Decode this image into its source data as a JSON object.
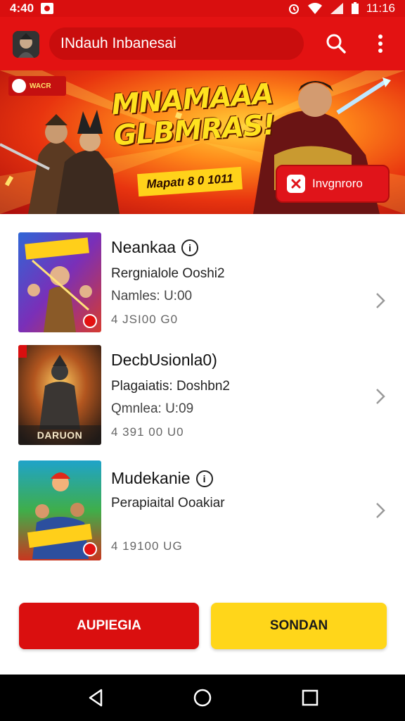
{
  "status_bar": {
    "time_left": "4:40",
    "time_right": "11:16",
    "background": "#d90f0f"
  },
  "app_bar": {
    "title": "INdauh Inbanesai",
    "icons": [
      "app-avatar",
      "search-icon",
      "more-vert-icon"
    ],
    "background": "#e31212"
  },
  "banner": {
    "badge": "WACR",
    "title": "MNAMAAA GLBMRAS!",
    "subtitle": "Mapatı 8 0 1011",
    "cta_label": "Invgnroro"
  },
  "items": [
    {
      "title": "Neankaa",
      "line1": "Rergnialole Ooshi2",
      "line2": "Namles: U:00",
      "price": "4 JSI00 G0",
      "has_info": true,
      "thumb_caption": ""
    },
    {
      "title": "DecbUsionla0)",
      "line1": "Plagaiatis: Doshbn2",
      "line2": "Qmnlea: U:09",
      "price": "4 391 00 U0",
      "has_info": false,
      "thumb_caption": "DARUON"
    },
    {
      "title": "Mudekanie",
      "line1": "Perapiaital Ooakiar",
      "line2": "",
      "price": "4 19100 UG",
      "has_info": true,
      "thumb_caption": ""
    }
  ],
  "info_glyph": "i",
  "buttons": {
    "primary": "AUPIEGIA",
    "secondary": "SONDAN"
  },
  "colors": {
    "brand_red": "#e31212",
    "accent_yellow": "#ffd61a"
  }
}
